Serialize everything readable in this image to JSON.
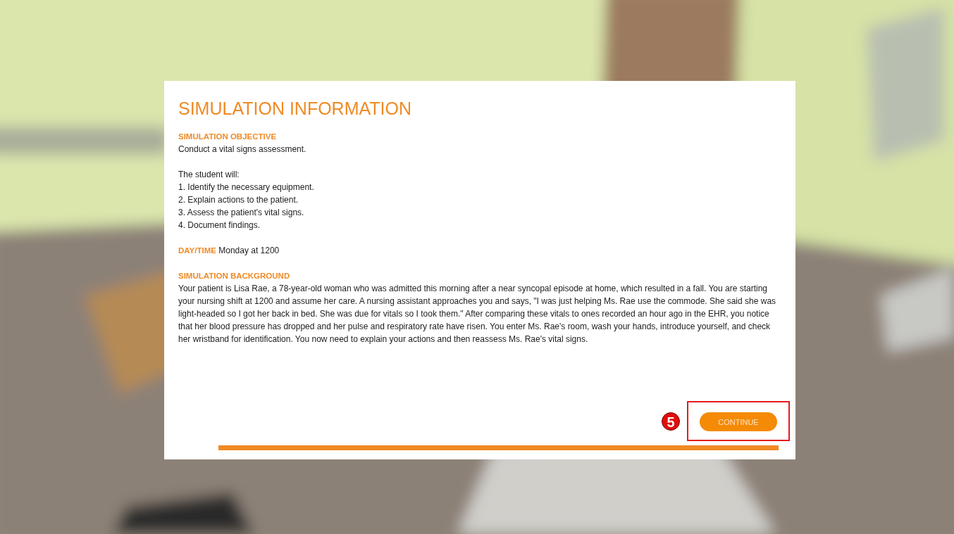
{
  "dialog": {
    "title": "SIMULATION INFORMATION",
    "objective": {
      "heading": "SIMULATION OBJECTIVE",
      "text": "Conduct a vital signs assessment."
    },
    "goals": {
      "intro": "The student will:",
      "items": [
        "1. Identify the necessary equipment.",
        "2. Explain actions to the patient.",
        "3. Assess the patient's vital signs.",
        "4. Document findings."
      ]
    },
    "day_time": {
      "label": "DAY/TIME",
      "value": "Monday at 1200"
    },
    "background": {
      "heading": "SIMULATION BACKGROUND",
      "text": "Your patient is Lisa Rae, a 78-year-old woman who was admitted this morning after a near syncopal episode at home, which resulted in a fall. You are starting your nursing shift at 1200 and assume her care. A nursing assistant approaches you and says, \"I was just helping Ms. Rae use the commode. She said she was light-headed so I got her back in bed. She was due for vitals so I took them.\" After comparing these vitals to ones recorded an hour ago in the EHR, you notice that her blood pressure has dropped and her pulse and respiratory rate have risen. You enter Ms. Rae's room, wash your hands, introduce yourself, and check her wristband for identification. You now need to explain your actions and then reassess Ms. Rae's vital signs."
    },
    "step_badge": "5",
    "continue_button": "CONTINUE"
  }
}
